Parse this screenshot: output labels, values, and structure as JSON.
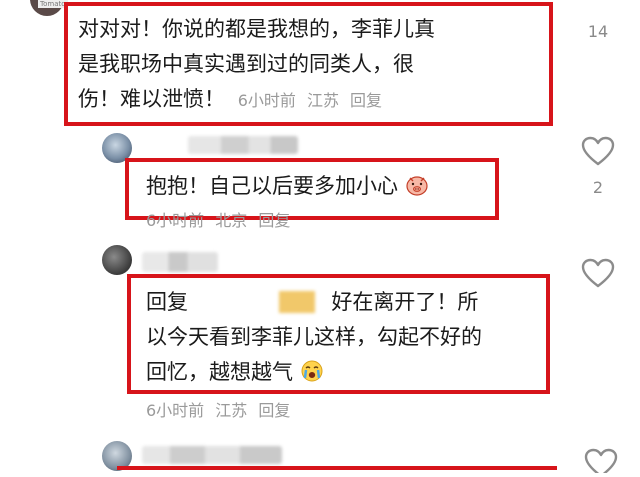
{
  "top_snippet": {
    "text": "Tomato"
  },
  "comments": [
    {
      "text_line1": "对对对！你说的都是我想的，李菲儿真",
      "text_line2": "是我职场中真实遇到过的同类人，很",
      "text_line3": "伤！难以泄愤！",
      "meta_inline": "6小时前  江苏  回复",
      "like_count": "14"
    },
    {
      "text": "抱抱！自己以后要多加小心",
      "emoji": "pig-face-emoji",
      "meta": "6小时前  北京  回复",
      "like_count": "2"
    },
    {
      "reply_prefix": "回复",
      "text_line1_rest": "好在离开了！所",
      "text_line2": "以今天看到李菲儿这样，勾起不好的",
      "text_line3": "回忆，越想越气",
      "emoji": "crying-emoji",
      "meta": "6小时前  江苏  回复"
    }
  ],
  "colors": {
    "highlight": "#d7141a",
    "meta": "#9a9a9a",
    "icon": "#8c8c8c"
  }
}
